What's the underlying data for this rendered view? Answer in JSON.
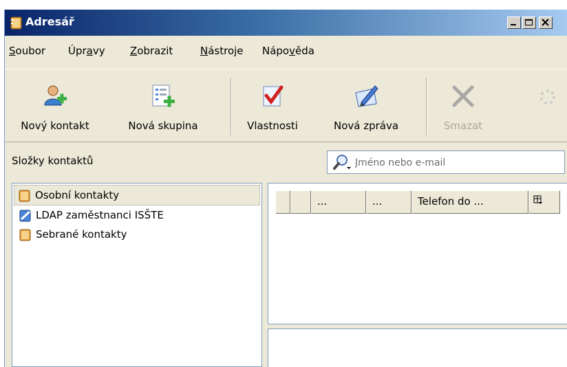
{
  "window": {
    "title": "Adresář"
  },
  "menu": {
    "items": [
      {
        "pre": "",
        "key": "S",
        "post": "oubor"
      },
      {
        "pre": "Úpr",
        "key": "a",
        "post": "vy"
      },
      {
        "pre": "",
        "key": "Z",
        "post": "obrazit"
      },
      {
        "pre": "",
        "key": "N",
        "post": "ástroje"
      },
      {
        "pre": "Nápo",
        "key": "v",
        "post": "ěda"
      }
    ]
  },
  "toolbar": {
    "new_contact": "Nový kontakt",
    "new_group": "Nová skupina",
    "properties": "Vlastnosti",
    "new_message": "Nová zpráva",
    "delete": "Smazat"
  },
  "folders": {
    "title": "Složky kontaktů",
    "items": [
      {
        "label": "Osobní kontakty",
        "icon": "addressbook-icon",
        "selected": true
      },
      {
        "label": "LDAP zaměstnanci ISŠTE",
        "icon": "ldap-directory-icon",
        "selected": false
      },
      {
        "label": "Sebrané kontakty",
        "icon": "addressbook-icon",
        "selected": false
      }
    ]
  },
  "search": {
    "placeholder": "Jméno nebo e-mail"
  },
  "contacts": {
    "columns": [
      "",
      "",
      "...",
      "...",
      "Telefon do ..."
    ]
  }
}
